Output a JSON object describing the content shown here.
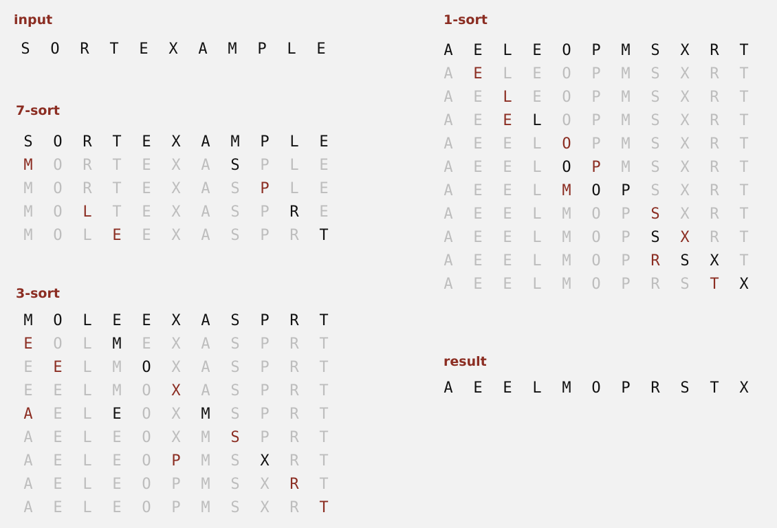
{
  "colors": {
    "black": "#111111",
    "red": "#8b2d22",
    "gray": "#bdbdbd",
    "heading": "#8b2d22",
    "background": "#f2f2f2"
  },
  "panels": {
    "input": {
      "title": "input",
      "rows": [
        {
          "letters": [
            "S",
            "O",
            "R",
            "T",
            "E",
            "X",
            "A",
            "M",
            "P",
            "L",
            "E"
          ],
          "colors": "bbbbbbbbbbb"
        }
      ]
    },
    "sort7": {
      "title": "7-sort",
      "rows": [
        {
          "letters": [
            "S",
            "O",
            "R",
            "T",
            "E",
            "X",
            "A",
            "M",
            "P",
            "L",
            "E"
          ],
          "colors": "bbbbbbbbbbb"
        },
        {
          "letters": [
            "M",
            "O",
            "R",
            "T",
            "E",
            "X",
            "A",
            "S",
            "P",
            "L",
            "E"
          ],
          "colors": "rggggggbggg"
        },
        {
          "letters": [
            "M",
            "O",
            "R",
            "T",
            "E",
            "X",
            "A",
            "S",
            "P",
            "L",
            "E"
          ],
          "colors": "ggggggggrgg"
        },
        {
          "letters": [
            "M",
            "O",
            "L",
            "T",
            "E",
            "X",
            "A",
            "S",
            "P",
            "R",
            "E"
          ],
          "colors": "ggrggggggbg"
        },
        {
          "letters": [
            "M",
            "O",
            "L",
            "E",
            "E",
            "X",
            "A",
            "S",
            "P",
            "R",
            "T"
          ],
          "colors": "gggrggggggb"
        }
      ]
    },
    "sort3": {
      "title": "3-sort",
      "rows": [
        {
          "letters": [
            "M",
            "O",
            "L",
            "E",
            "E",
            "X",
            "A",
            "S",
            "P",
            "R",
            "T"
          ],
          "colors": "bbbbbbbbbbb"
        },
        {
          "letters": [
            "E",
            "O",
            "L",
            "M",
            "E",
            "X",
            "A",
            "S",
            "P",
            "R",
            "T"
          ],
          "colors": "rggbggggggg"
        },
        {
          "letters": [
            "E",
            "E",
            "L",
            "M",
            "O",
            "X",
            "A",
            "S",
            "P",
            "R",
            "T"
          ],
          "colors": "grggbgggggg"
        },
        {
          "letters": [
            "E",
            "E",
            "L",
            "M",
            "O",
            "X",
            "A",
            "S",
            "P",
            "R",
            "T"
          ],
          "colors": "gggggrggggg"
        },
        {
          "letters": [
            "A",
            "E",
            "L",
            "E",
            "O",
            "X",
            "M",
            "S",
            "P",
            "R",
            "T"
          ],
          "colors": "rggbggbgggg"
        },
        {
          "letters": [
            "A",
            "E",
            "L",
            "E",
            "O",
            "X",
            "M",
            "S",
            "P",
            "R",
            "T"
          ],
          "colors": "gggggggrggg"
        },
        {
          "letters": [
            "A",
            "E",
            "L",
            "E",
            "O",
            "P",
            "M",
            "S",
            "X",
            "R",
            "T"
          ],
          "colors": "gggggrggbgg"
        },
        {
          "letters": [
            "A",
            "E",
            "L",
            "E",
            "O",
            "P",
            "M",
            "S",
            "X",
            "R",
            "T"
          ],
          "colors": "gggggggggrg"
        },
        {
          "letters": [
            "A",
            "E",
            "L",
            "E",
            "O",
            "P",
            "M",
            "S",
            "X",
            "R",
            "T"
          ],
          "colors": "ggggggggggr"
        }
      ]
    },
    "sort1": {
      "title": "1-sort",
      "rows": [
        {
          "letters": [
            "A",
            "E",
            "L",
            "E",
            "O",
            "P",
            "M",
            "S",
            "X",
            "R",
            "T"
          ],
          "colors": "bbbbbbbbbbb"
        },
        {
          "letters": [
            "A",
            "E",
            "L",
            "E",
            "O",
            "P",
            "M",
            "S",
            "X",
            "R",
            "T"
          ],
          "colors": "grggggggggg"
        },
        {
          "letters": [
            "A",
            "E",
            "L",
            "E",
            "O",
            "P",
            "M",
            "S",
            "X",
            "R",
            "T"
          ],
          "colors": "ggrgggggggg"
        },
        {
          "letters": [
            "A",
            "E",
            "E",
            "L",
            "O",
            "P",
            "M",
            "S",
            "X",
            "R",
            "T"
          ],
          "colors": "ggrbggggggg"
        },
        {
          "letters": [
            "A",
            "E",
            "E",
            "L",
            "O",
            "P",
            "M",
            "S",
            "X",
            "R",
            "T"
          ],
          "colors": "ggggrgggggg"
        },
        {
          "letters": [
            "A",
            "E",
            "E",
            "L",
            "O",
            "P",
            "M",
            "S",
            "X",
            "R",
            "T"
          ],
          "colors": "ggggbrggggg"
        },
        {
          "letters": [
            "A",
            "E",
            "E",
            "L",
            "M",
            "O",
            "P",
            "S",
            "X",
            "R",
            "T"
          ],
          "colors": "ggggrbbgggg"
        },
        {
          "letters": [
            "A",
            "E",
            "E",
            "L",
            "M",
            "O",
            "P",
            "S",
            "X",
            "R",
            "T"
          ],
          "colors": "gggggggrggg"
        },
        {
          "letters": [
            "A",
            "E",
            "E",
            "L",
            "M",
            "O",
            "P",
            "S",
            "X",
            "R",
            "T"
          ],
          "colors": "gggggggbrgg"
        },
        {
          "letters": [
            "A",
            "E",
            "E",
            "L",
            "M",
            "O",
            "P",
            "R",
            "S",
            "X",
            "T"
          ],
          "colors": "gggggggrbbg"
        },
        {
          "letters": [
            "A",
            "E",
            "E",
            "L",
            "M",
            "O",
            "P",
            "R",
            "S",
            "T",
            "X"
          ],
          "colors": "gggggggggrb"
        }
      ]
    },
    "result": {
      "title": "result",
      "rows": [
        {
          "letters": [
            "A",
            "E",
            "E",
            "L",
            "M",
            "O",
            "P",
            "R",
            "S",
            "T",
            "X"
          ],
          "colors": "bbbbbbbbbbb"
        }
      ]
    }
  }
}
